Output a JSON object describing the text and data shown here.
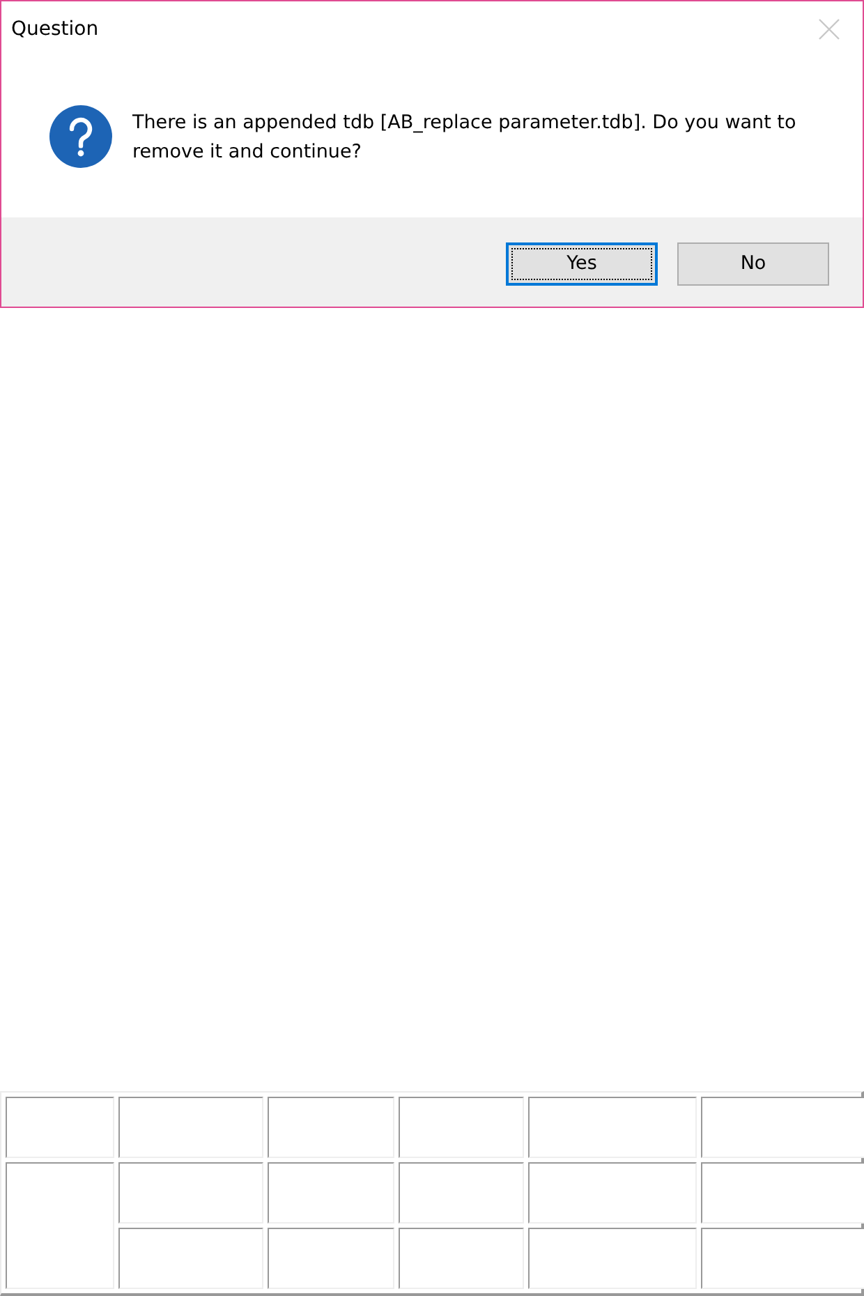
{
  "window": {
    "title": "Question"
  },
  "message": "There is an appended tdb [AB_replace parameter.tdb]. Do you want to remove it and continue?",
  "buttons": [
    {
      "label": "Yes",
      "selected": true
    },
    {
      "label": "No",
      "selected": false
    }
  ]
}
